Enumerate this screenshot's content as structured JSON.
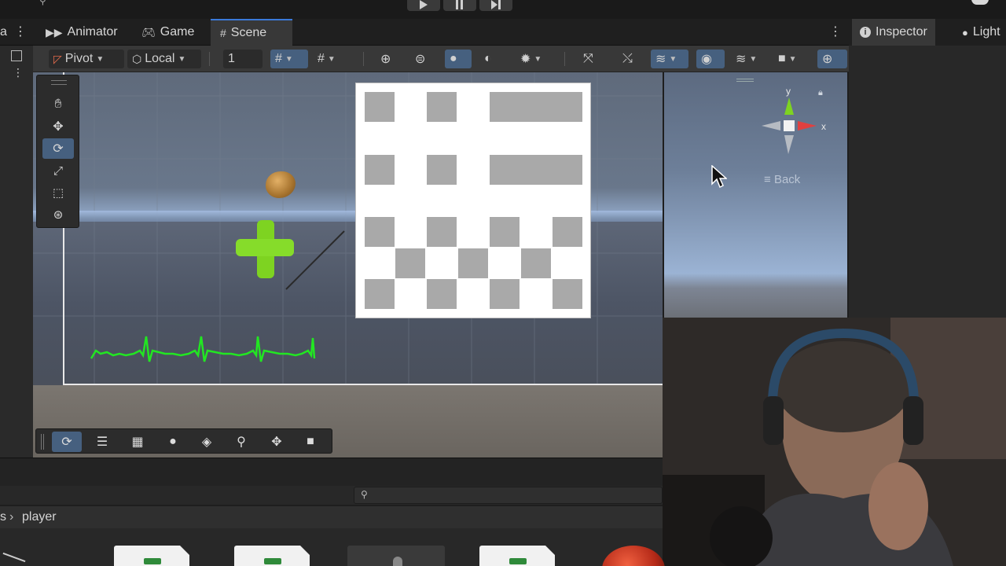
{
  "tabs": {
    "animator": "Animator",
    "game": "Game",
    "scene": "Scene"
  },
  "inspector_tabs": {
    "inspector": "Inspector",
    "lighting": "Light"
  },
  "toolbar": {
    "pivot": "Pivot",
    "local": "Local",
    "grid_value": "1"
  },
  "gizmo": {
    "axis_y": "y",
    "axis_x": "x",
    "back": "Back"
  },
  "project": {
    "breadcrumb_parent": "s",
    "breadcrumb_current": "player"
  },
  "colors": {
    "accent_blue": "#46607f",
    "tab_highlight": "#3a79d9",
    "green_object": "#7ed321",
    "heartbeat": "#22e622"
  },
  "icons": {
    "play": "play-icon",
    "pause": "pause-icon",
    "step": "step-icon",
    "hand": "hand-tool-icon",
    "move": "move-tool-icon",
    "rotate": "rotate-tool-icon",
    "scale": "scale-tool-icon",
    "rect": "rect-tool-icon",
    "transform": "transform-tool-icon"
  }
}
